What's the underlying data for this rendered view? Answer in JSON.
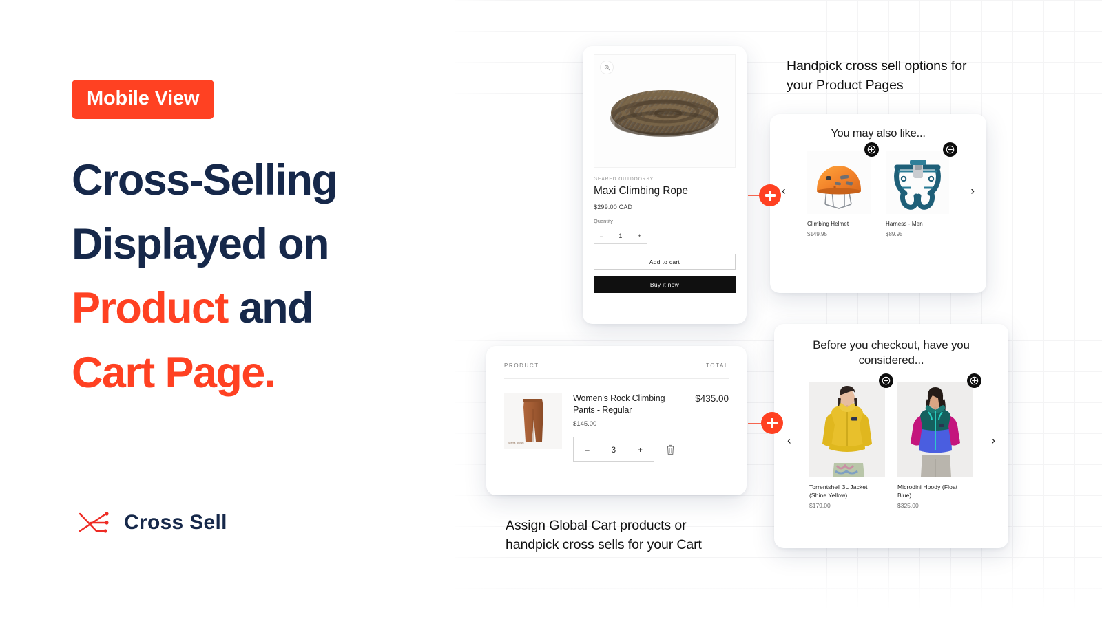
{
  "meta": {
    "accent_color": "#ff4122",
    "headline_color": "#16284a"
  },
  "left": {
    "badge_label": "Mobile View",
    "headline": {
      "line1": "Cross-Selling",
      "line2": "Displayed on",
      "line3_accent": "Product",
      "line3_rest": " and",
      "line4_accent": "Cart Page",
      "line4_period": "."
    },
    "logo_text": "Cross Sell"
  },
  "captions": {
    "product_pages": "Handpick cross sell options for your Product Pages",
    "cart": "Assign Global Cart products or handpick cross sells for your Cart"
  },
  "product_card": {
    "zoom_icon": "magnify-icon",
    "vendor": "GEARED.OUTDOORSY",
    "title": "Maxi Climbing Rope",
    "price": "$299.00 CAD",
    "quantity_label": "Quantity",
    "quantity_value": "1",
    "minus": "–",
    "plus": "+",
    "add_to_cart_label": "Add to cart",
    "buy_now_label": "Buy it now"
  },
  "crosssell_product": {
    "heading": "You may also like...",
    "prev_arrow": "‹",
    "next_arrow": "›",
    "items": [
      {
        "name": "Climbing Helmet",
        "price": "$149.95",
        "image": "climbing-helmet-image"
      },
      {
        "name": "Harness - Men",
        "price": "$89.95",
        "image": "climbing-harness-image"
      }
    ]
  },
  "cart_card": {
    "col_product": "PRODUCT",
    "col_total": "TOTAL",
    "item": {
      "title": "Women's Rock Climbing Pants - Regular",
      "unit_price": "$145.00",
      "line_total": "$435.00",
      "quantity": "3",
      "minus": "–",
      "plus": "+",
      "thumb_caption": "Sierra Brown",
      "remove_icon": "trash-icon"
    }
  },
  "crosssell_cart": {
    "heading": "Before you checkout, have you considered...",
    "prev_arrow": "‹",
    "next_arrow": "›",
    "items": [
      {
        "name": "Torrentshell 3L Jacket (Shine Yellow)",
        "price": "$179.00",
        "image": "yellow-jacket-model-image"
      },
      {
        "name": "Microdini Hoody (Float Blue)",
        "price": "$325.00",
        "image": "colorblock-hoody-model-image"
      }
    ]
  }
}
